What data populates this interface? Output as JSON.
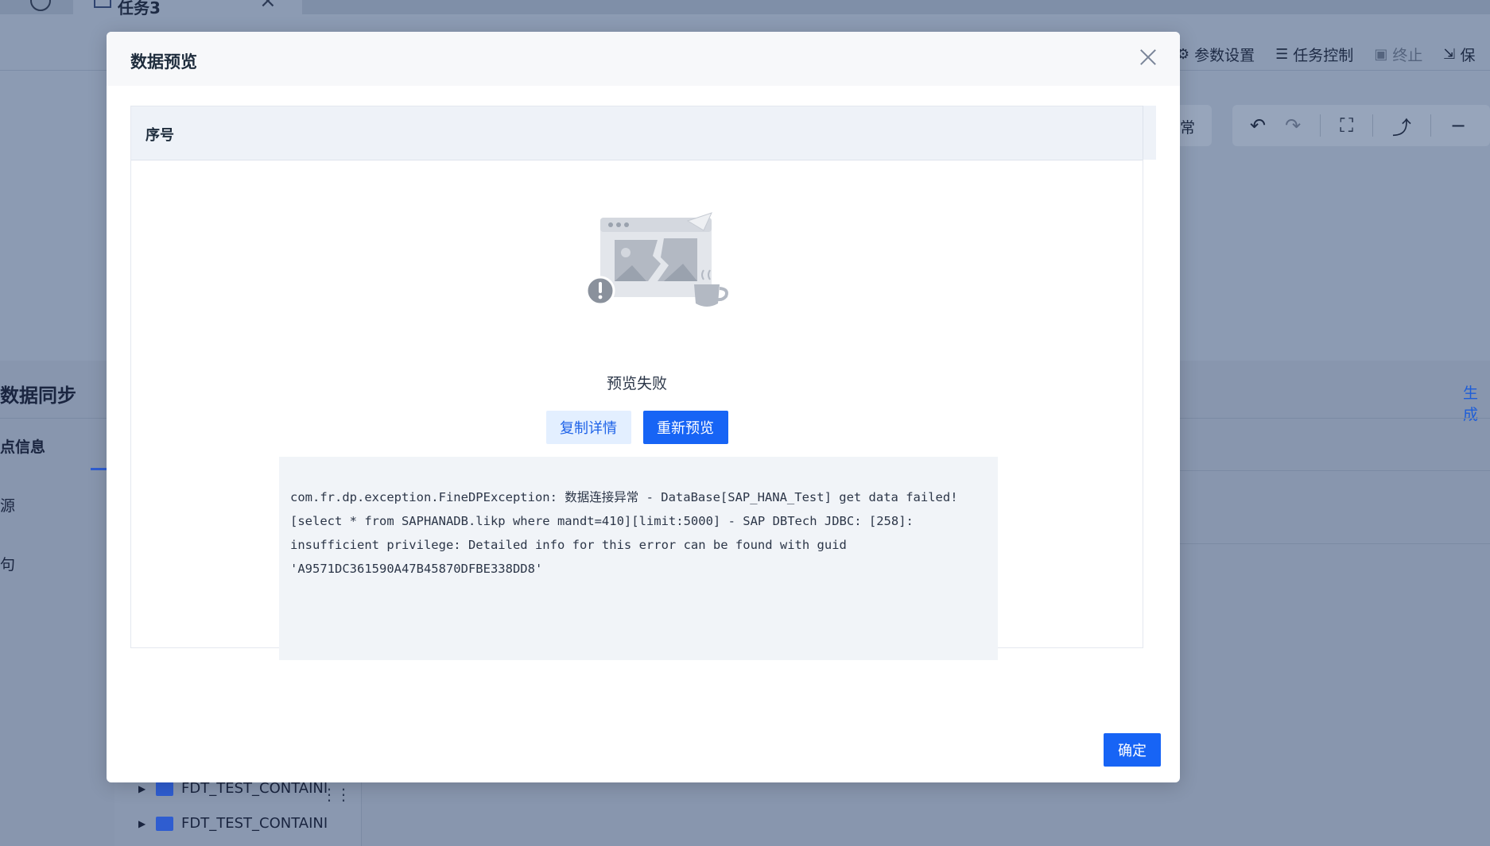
{
  "background": {
    "tab": {
      "label": "任务3"
    },
    "toolbar": {
      "items": [
        {
          "label": "参数设置",
          "icon": "gear-icon"
        },
        {
          "label": "任务控制",
          "icon": "sliders-icon"
        },
        {
          "label": "终止",
          "icon": "stop-icon"
        },
        {
          "label": "保",
          "icon": "save-icon"
        }
      ]
    },
    "status_text": "常",
    "panel": {
      "title": "数据同步",
      "generate_link": "生成",
      "side_items": [
        "点信息",
        "源",
        "句"
      ]
    },
    "tree": {
      "items": [
        "FDT_TEST_CONTAINI",
        "FDT_TEST_CONTAINI"
      ]
    }
  },
  "modal": {
    "title": "数据预览",
    "column_header": "序号",
    "status_message": "预览失败",
    "copy_button": "复制详情",
    "retry_button": "重新预览",
    "error_detail": "com.fr.dp.exception.FineDPException: 数据连接异常 - DataBase[SAP_HANA_Test] get data failed! [select * from SAPHANADB.likp where mandt=410][limit:5000] - SAP DBTech JDBC: [258]: insufficient privilege: Detailed info for this error can be found with guid 'A9571DC361590A47B45870DFBE338DD8'",
    "confirm_button": "确定",
    "colors": {
      "primary": "#1764f5",
      "light_button": "#e3efff",
      "error_bg": "#f1f4f8"
    }
  }
}
